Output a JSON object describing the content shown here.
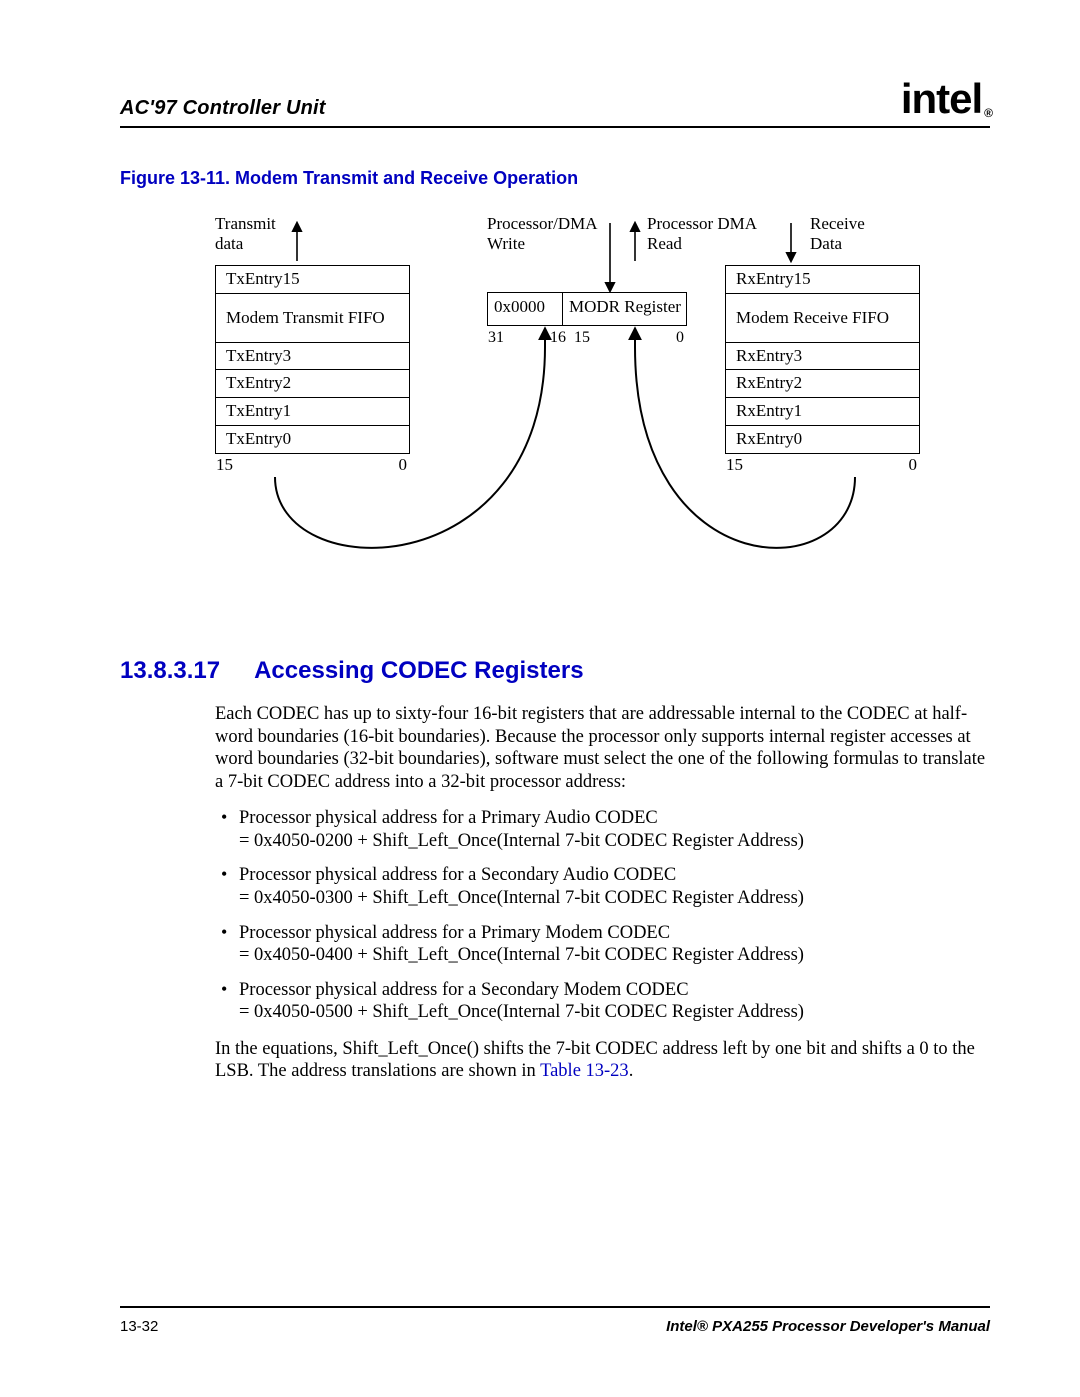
{
  "header": {
    "title": "AC'97 Controller Unit",
    "logo_text": "intel",
    "logo_reg": "®"
  },
  "figure": {
    "caption": "Figure 13-11. Modem Transmit and Receive Operation",
    "tx_top_label_line1": "Transmit",
    "tx_top_label_line2": "data",
    "write_label_line1": "Processor/DMA",
    "write_label_line2": "Write",
    "read_label_line1": "Processor DMA",
    "read_label_line2": "Read",
    "rx_top_label_line1": "Receive",
    "rx_top_label_line2": "Data",
    "tx_entries": {
      "e15": "TxEntry15",
      "mid": "Modem Transmit FIFO",
      "e3": "TxEntry3",
      "e2": "TxEntry2",
      "e1": "TxEntry1",
      "e0": "TxEntry0"
    },
    "rx_entries": {
      "e15": "RxEntry15",
      "mid": "Modem Receive FIFO",
      "e3": "RxEntry3",
      "e2": "RxEntry2",
      "e1": "RxEntry1",
      "e0": "RxEntry0"
    },
    "modr_left": "0x0000",
    "modr_right": "MODR Register",
    "modr_bit_31": "31",
    "modr_bit_16": "16",
    "modr_bit_15": "15",
    "modr_bit_0": "0",
    "bit_hi": "15",
    "bit_lo": "0"
  },
  "section": {
    "number": "13.8.3.17",
    "title": "Accessing CODEC Registers",
    "para1": "Each CODEC has up to sixty-four 16-bit registers that are addressable internal to the CODEC at half-word boundaries (16-bit boundaries). Because the processor only supports internal register accesses at word boundaries (32-bit boundaries), software must select the one of the following formulas to translate a 7-bit CODEC address into a 32-bit processor address:",
    "bullets": [
      {
        "l1": "Processor physical address for a Primary Audio CODEC",
        "l2": "= 0x4050-0200 + Shift_Left_Once(Internal 7-bit CODEC Register Address)"
      },
      {
        "l1": "Processor physical address for a Secondary Audio CODEC",
        "l2": "= 0x4050-0300 + Shift_Left_Once(Internal 7-bit CODEC Register Address)"
      },
      {
        "l1": "Processor physical address for a Primary Modem CODEC",
        "l2": "= 0x4050-0400 + Shift_Left_Once(Internal 7-bit CODEC Register Address)"
      },
      {
        "l1": "Processor physical address for a Secondary Modem CODEC",
        "l2": "= 0x4050-0500 + Shift_Left_Once(Internal 7-bit CODEC Register Address)"
      }
    ],
    "para2_a": "In the equations, Shift_Left_Once() shifts the 7-bit CODEC address left by one bit and shifts a 0 to the LSB. The address translations are shown in ",
    "para2_link": "Table 13-23",
    "para2_b": "."
  },
  "footer": {
    "page": "13-32",
    "manual": "Intel® PXA255 Processor Developer's Manual"
  }
}
